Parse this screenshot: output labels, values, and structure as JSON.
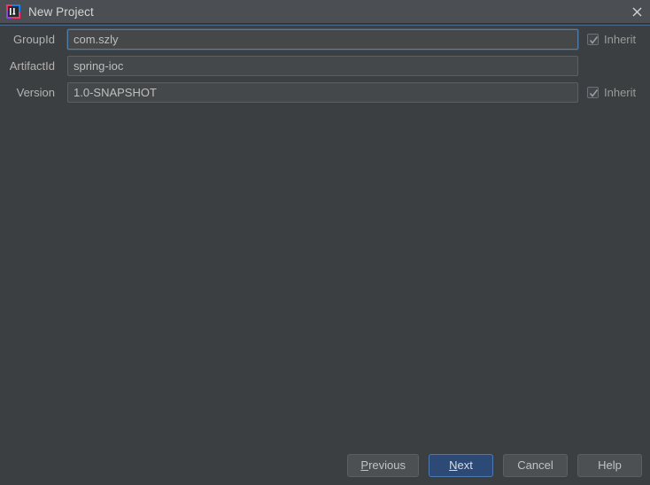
{
  "window": {
    "title": "New Project",
    "app_icon": "intellij-idea-icon",
    "close_icon": "close-icon"
  },
  "form": {
    "rows": [
      {
        "label": "GroupId",
        "value": "com.szly",
        "placeholder": "",
        "focused": true,
        "inherit": {
          "label": "Inherit",
          "checked": true,
          "visible": true
        }
      },
      {
        "label": "ArtifactId",
        "value": "spring-ioc",
        "placeholder": "",
        "focused": false,
        "inherit": {
          "label": "",
          "checked": false,
          "visible": false
        }
      },
      {
        "label": "Version",
        "value": "1.0-SNAPSHOT",
        "placeholder": "",
        "focused": false,
        "inherit": {
          "label": "Inherit",
          "checked": true,
          "visible": true
        }
      }
    ]
  },
  "buttons": {
    "previous": {
      "label": "Previous",
      "mnemonic": "P",
      "rest": "revious",
      "default": false
    },
    "next": {
      "label": "Next",
      "mnemonic": "N",
      "rest": "ext",
      "default": true
    },
    "cancel": {
      "label": "Cancel",
      "default": false
    },
    "help": {
      "label": "Help",
      "default": false
    }
  },
  "colors": {
    "background": "#3c3f41",
    "titlebar": "#4b4f53",
    "field_bg": "#45484a",
    "field_border": "#5c6063",
    "focus_border": "#4d7eae",
    "default_button_bg": "#2d4a77",
    "default_button_border": "#4a7ab0",
    "text": "#bbbbbb"
  }
}
